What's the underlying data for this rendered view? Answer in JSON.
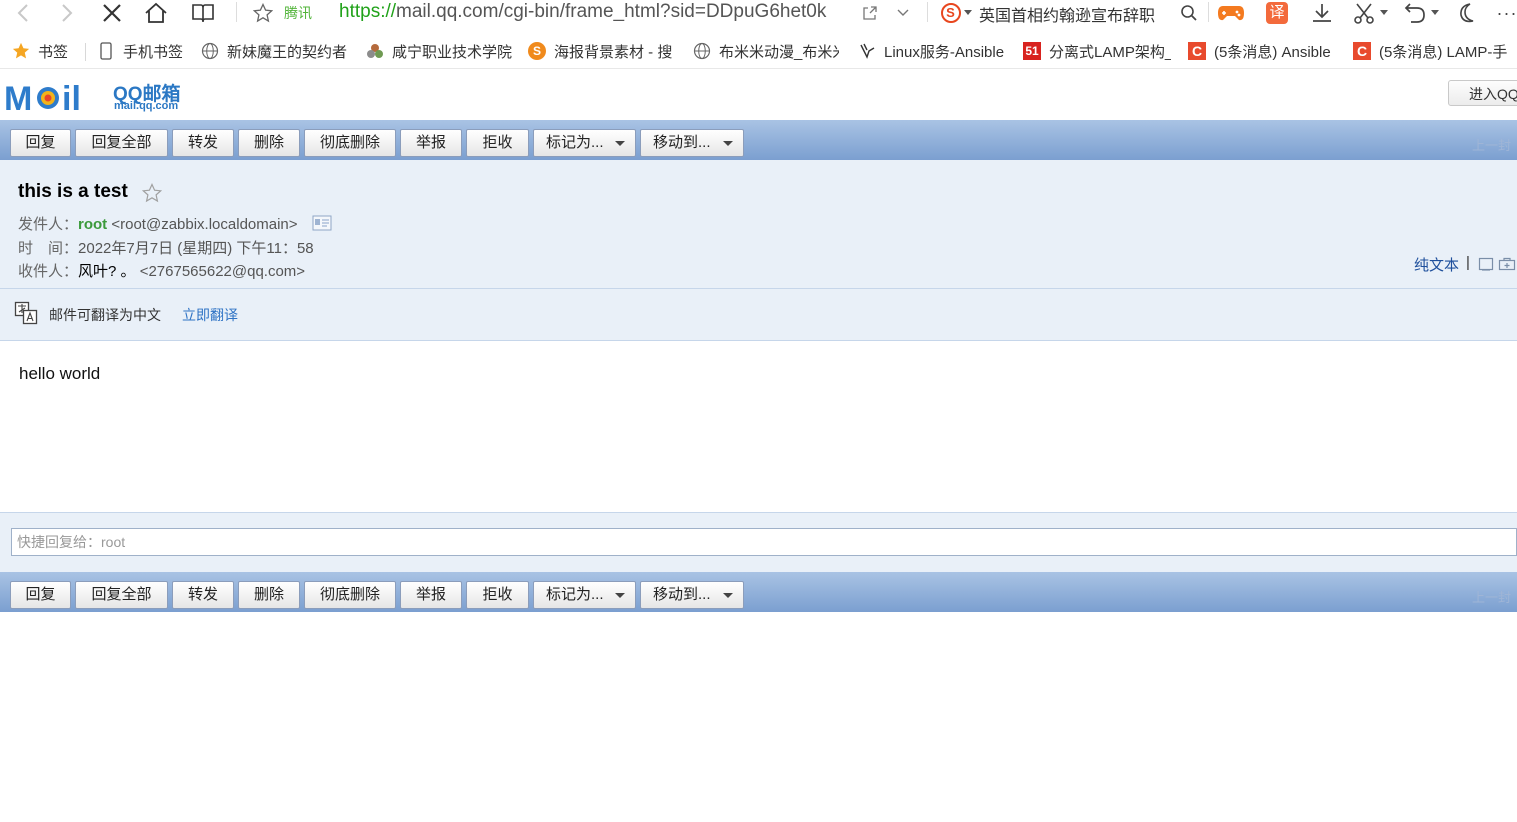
{
  "browser": {
    "site_tag": "腾讯",
    "url_protocol": "https://",
    "url_rest": "mail.qq.com/cgi-bin/frame_html?sid=DDpuG6het0k",
    "sogou_label": "S",
    "hot_news": "英国首相约翰逊宣布辞职",
    "translate_label": "译",
    "more_label": "···"
  },
  "bookmarks": [
    {
      "label": "书签",
      "icon": "star-icon"
    },
    {
      "label": "手机书签",
      "icon": "phone-icon"
    },
    {
      "label": "新妹魔王的契约者",
      "icon": "globe-icon"
    },
    {
      "label": "咸宁职业技术学院",
      "icon": "school-icon"
    },
    {
      "label": "海报背景素材 - 搜",
      "icon": "sogou-icon"
    },
    {
      "label": "布米米动漫_布米米",
      "icon": "globe-icon"
    },
    {
      "label": "Linux服务-Ansible",
      "icon": "linux-icon"
    },
    {
      "label": "分离式LAMP架构_",
      "icon": "51cto-icon"
    },
    {
      "label": "(5条消息) Ansible",
      "icon": "csdn-icon"
    },
    {
      "label": "(5条消息) LAMP-手",
      "icon": "csdn-icon"
    }
  ],
  "bookmark_badges": {
    "cto": "51",
    "csdn": "C"
  },
  "logo": {
    "mark": "Mail",
    "cn": "QQ邮箱",
    "url": "mail.qq.com"
  },
  "header": {
    "enter_label": "进入QQ邮箱"
  },
  "toolbar": {
    "buttons": [
      "回复",
      "回复全部",
      "转发",
      "删除",
      "彻底删除",
      "举报",
      "拒收"
    ],
    "mark_as": "标记为...",
    "move_to": "移动到...",
    "pager": "上一封"
  },
  "mail": {
    "subject": "this is a test",
    "from_label": "发件人：",
    "from_name": "root",
    "from_email": "<root@zabbix.localdomain>",
    "time_label": "时　间：",
    "time_value": "2022年7月7日 (星期四) 下午11：58",
    "to_label": "收件人：",
    "to_name": "风叶? 。",
    "to_email": "<2767565622@qq.com>",
    "plain_text": "纯文本",
    "plain_sep": "|",
    "translate_text": "邮件可翻译为中文",
    "translate_link": "立即翻译",
    "body": "hello world"
  },
  "quick_reply": {
    "placeholder": "快捷回复给：root"
  },
  "colors": {
    "toolbar_top": "#a9c3e4",
    "toolbar_bottom": "#7b9fd0",
    "info_bg": "#e9f0f8",
    "link": "#2f73c5",
    "sender": "#3b9a3b",
    "address_green": "#21a21a"
  }
}
